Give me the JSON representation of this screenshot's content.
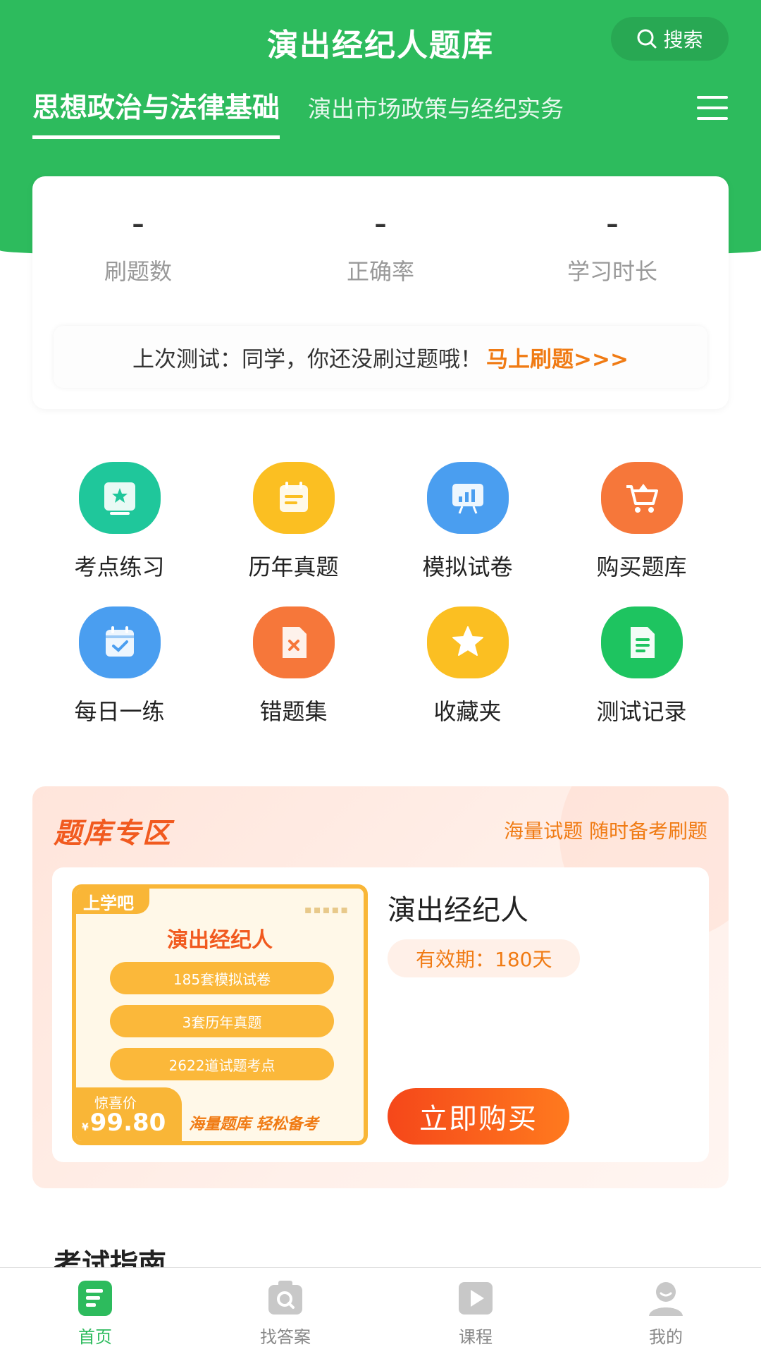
{
  "header": {
    "title": "演出经纪人题库",
    "search_label": "搜索",
    "tabs": [
      {
        "label": "思想政治与法律基础",
        "active": true
      },
      {
        "label": "演出市场政策与经纪实务",
        "active": false
      }
    ]
  },
  "stats": [
    {
      "value": "–",
      "label": "刷题数"
    },
    {
      "value": "–",
      "label": "正确率"
    },
    {
      "value": "–",
      "label": "学习时长"
    }
  ],
  "last_test": {
    "text": "上次测试：同学，你还没刷过题哦！",
    "link": "马上刷题>>>"
  },
  "grid": [
    {
      "label": "考点练习",
      "icon": "star-board-icon",
      "color": "#1fc79b"
    },
    {
      "label": "历年真题",
      "icon": "calendar-doc-icon",
      "color": "#fbbf22"
    },
    {
      "label": "模拟试卷",
      "icon": "presentation-icon",
      "color": "#4a9ef0"
    },
    {
      "label": "购买题库",
      "icon": "cart-icon",
      "color": "#f6773a"
    },
    {
      "label": "每日一练",
      "icon": "calendar-check-icon",
      "color": "#4a9ef0"
    },
    {
      "label": "错题集",
      "icon": "wrong-doc-icon",
      "color": "#f6773a"
    },
    {
      "label": "收藏夹",
      "icon": "star-icon",
      "color": "#fbbf22"
    },
    {
      "label": "测试记录",
      "icon": "document-icon",
      "color": "#1ec460"
    }
  ],
  "zone": {
    "title": "题库专区",
    "subtitle": "海量试题 随时备考刷题",
    "product": {
      "title": "演出经纪人",
      "validity": "有效期：180天",
      "buy_label": "立即购买",
      "cover": {
        "logo": "上学吧",
        "dots": "▪▪▪▪▪",
        "name": "演出经纪人",
        "pills": [
          "185套模拟试卷",
          "3套历年真题",
          "2622道试题考点"
        ],
        "price_label": "惊喜价",
        "currency": "¥",
        "price": "99.80",
        "slogan": "海量题库 轻松备考"
      }
    }
  },
  "guide_title": "考试指南",
  "bottom_nav": [
    {
      "label": "首页",
      "icon": "home-doc-icon",
      "active": true
    },
    {
      "label": "找答案",
      "icon": "search-answer-icon",
      "active": false
    },
    {
      "label": "课程",
      "icon": "video-play-icon",
      "active": false
    },
    {
      "label": "我的",
      "icon": "user-icon",
      "active": false
    }
  ],
  "colors": {
    "brand": "#2dbb5d",
    "accent": "#f07b14"
  }
}
